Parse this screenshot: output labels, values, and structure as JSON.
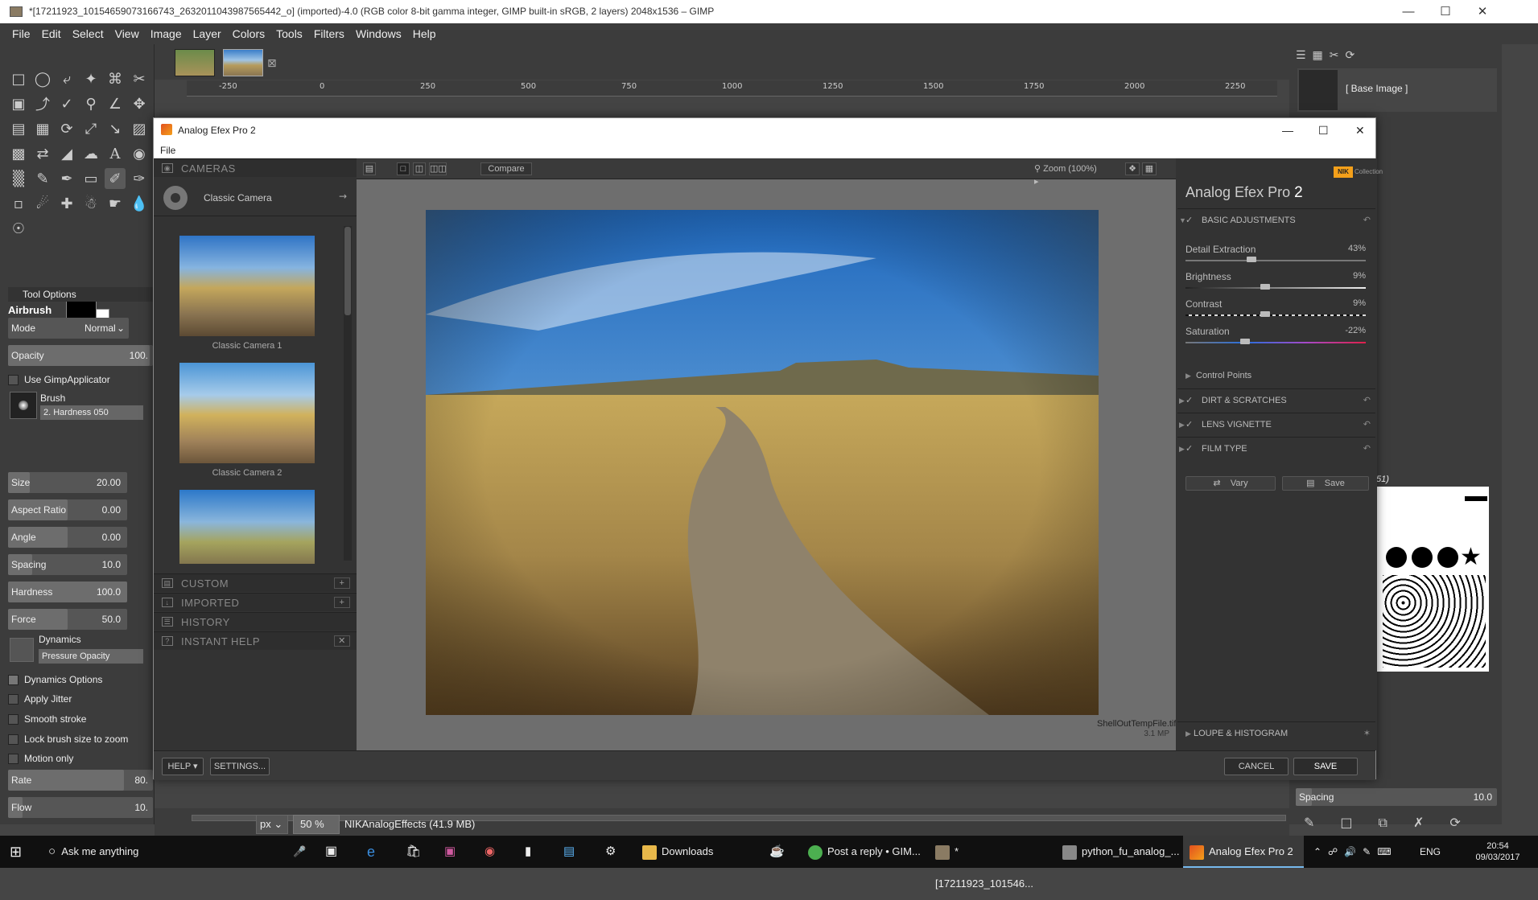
{
  "gimp": {
    "title": "*[17211923_10154659073166743_2632011043987565442_o] (imported)-4.0 (RGB color 8-bit gamma integer, GIMP built-in sRGB, 2 layers) 2048x1536 – GIMP",
    "menu": [
      "File",
      "Edit",
      "Select",
      "View",
      "Image",
      "Layer",
      "Colors",
      "Tools",
      "Filters",
      "Windows",
      "Help"
    ],
    "ruler_ticks": [
      "-250",
      "0",
      "250",
      "500",
      "750",
      "1000",
      "1250",
      "1500",
      "1750",
      "2000",
      "2250"
    ],
    "tool_options": {
      "header": "Tool Options",
      "tool_name": "Airbrush",
      "mode_label": "Mode",
      "mode_value": "Normal",
      "opacity_label": "Opacity",
      "opacity_value": "100.",
      "use_gimp_applicator": "Use GimpApplicator",
      "brush_label": "Brush",
      "brush_value": "2. Hardness 050",
      "size_label": "Size",
      "size_value": "20.00",
      "aspect_label": "Aspect Ratio",
      "aspect_value": "0.00",
      "angle_label": "Angle",
      "angle_value": "0.00",
      "spacing_label": "Spacing",
      "spacing_value": "10.0",
      "hardness_label": "Hardness",
      "hardness_value": "100.0",
      "force_label": "Force",
      "force_value": "50.0",
      "dynamics_label": "Dynamics",
      "dynamics_value": "Pressure Opacity",
      "dynamics_options": "Dynamics Options",
      "apply_jitter": "Apply Jitter",
      "smooth_stroke": "Smooth stroke",
      "lock_brush": "Lock brush size to zoom",
      "motion_only": "Motion only",
      "rate_label": "Rate",
      "rate_value": "80.",
      "flow_label": "Flow",
      "flow_value": "10."
    },
    "status": {
      "unit": "px",
      "zoom": "50 %",
      "message": "NIKAnalogEffects (41.9 MB)"
    },
    "layers": {
      "base_image": "[ Base Image ]"
    },
    "brushes": {
      "label": "51)",
      "spacing_label": "Spacing",
      "spacing_value": "10.0"
    }
  },
  "dialog": {
    "title": "Analog Efex Pro 2",
    "menu_file": "File",
    "left": {
      "cameras": "CAMERAS",
      "classic_camera": "Classic Camera",
      "presets": [
        "Classic Camera 1",
        "Classic Camera 2",
        ""
      ],
      "custom": "CUSTOM",
      "imported": "IMPORTED",
      "history": "HISTORY",
      "instant_help": "INSTANT HELP"
    },
    "center": {
      "compare": "Compare",
      "zoom": "Zoom (100%)",
      "file_name": "ShellOutTempFile.tiff",
      "file_size": "3.1 MP"
    },
    "right": {
      "nik_logo": "NIK",
      "collection": "Collection",
      "product": "Analog Efex Pro",
      "product_version": "2",
      "basic_adjustments": "BASIC ADJUSTMENTS",
      "sliders": [
        {
          "name": "Detail Extraction",
          "value": "43%",
          "level": 0.36
        },
        {
          "name": "Brightness",
          "value": "9%",
          "level": 0.44
        },
        {
          "name": "Contrast",
          "value": "9%",
          "level": 0.44
        },
        {
          "name": "Saturation",
          "value": "-22%",
          "level": 0.32
        }
      ],
      "control_points": "Control Points",
      "dirt_scratches": "DIRT & SCRATCHES",
      "lens_vignette": "LENS VIGNETTE",
      "film_type": "FILM TYPE",
      "vary": "Vary",
      "save": "Save",
      "loupe": "LOUPE & HISTOGRAM"
    },
    "footer": {
      "help": "HELP",
      "settings": "SETTINGS...",
      "cancel": "CANCEL",
      "save": "SAVE"
    }
  },
  "taskbar": {
    "search": "Ask me anything",
    "items": [
      "Downloads",
      "Post a reply • GIM...",
      "*[17211923_101546...",
      "python_fu_analog_...",
      "Analog Efex Pro 2"
    ],
    "lang": "ENG",
    "time": "20:54",
    "date": "09/03/2017"
  }
}
